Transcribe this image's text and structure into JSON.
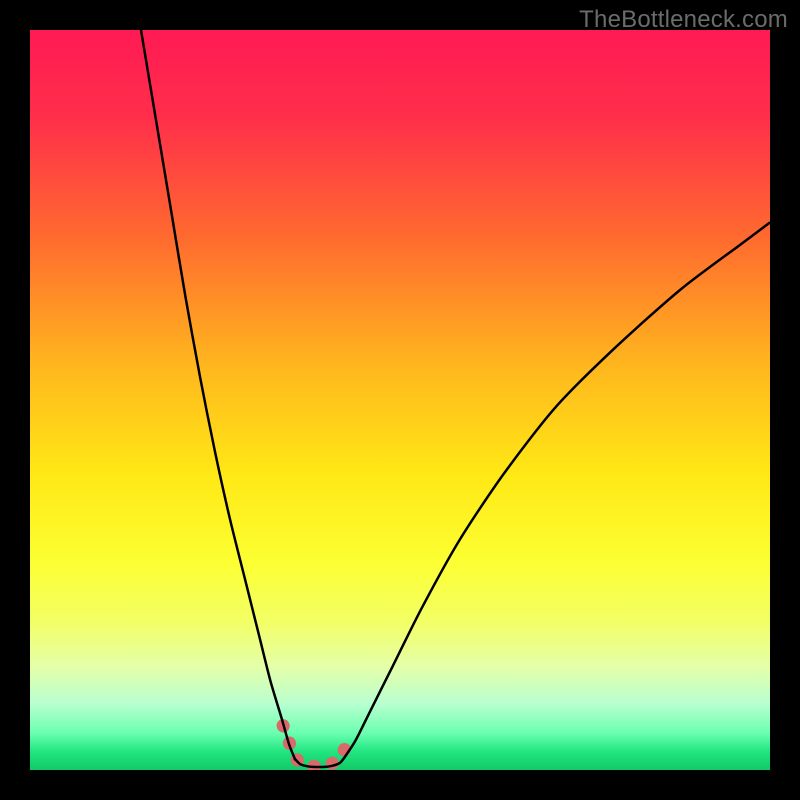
{
  "watermark": {
    "text": "TheBottleneck.com"
  },
  "chart_data": {
    "type": "line",
    "title": "",
    "xlabel": "",
    "ylabel": "",
    "xlim": [
      0,
      100
    ],
    "ylim": [
      0,
      100
    ],
    "grid": false,
    "legend": false,
    "gradient_stops": [
      {
        "offset": 0.0,
        "color": "#ff1a54"
      },
      {
        "offset": 0.12,
        "color": "#ff2f4a"
      },
      {
        "offset": 0.28,
        "color": "#ff6a2f"
      },
      {
        "offset": 0.45,
        "color": "#ffb51e"
      },
      {
        "offset": 0.6,
        "color": "#ffe815"
      },
      {
        "offset": 0.72,
        "color": "#fcff33"
      },
      {
        "offset": 0.8,
        "color": "#f3ff66"
      },
      {
        "offset": 0.86,
        "color": "#e4ffa8"
      },
      {
        "offset": 0.91,
        "color": "#b9ffcf"
      },
      {
        "offset": 0.95,
        "color": "#6bffb0"
      },
      {
        "offset": 0.975,
        "color": "#21e680"
      },
      {
        "offset": 1.0,
        "color": "#12c966"
      }
    ],
    "series": [
      {
        "name": "left-branch",
        "x": [
          15,
          17,
          19,
          21,
          23,
          25,
          27,
          29,
          31,
          32.5,
          34,
          35,
          35.8
        ],
        "y": [
          100,
          88,
          76,
          64,
          53,
          43,
          34,
          26,
          18,
          12,
          7,
          3.5,
          1.5
        ]
      },
      {
        "name": "valley-floor",
        "x": [
          35.8,
          36.5,
          37.5,
          39,
          40.5,
          41.8,
          42.5
        ],
        "y": [
          1.5,
          0.8,
          0.5,
          0.4,
          0.5,
          0.9,
          1.7
        ]
      },
      {
        "name": "right-branch",
        "x": [
          42.5,
          44,
          46,
          49,
          53,
          58,
          64,
          71,
          79,
          88,
          96,
          100
        ],
        "y": [
          1.7,
          4,
          8,
          14,
          22,
          31,
          40,
          49,
          57,
          65,
          71,
          74
        ]
      }
    ],
    "highlight": {
      "name": "valley-highlight",
      "x": [
        34.2,
        34.8,
        35.3,
        35.8,
        36.4,
        37.2,
        38.2,
        39.3,
        40.3,
        41.2,
        41.9,
        42.5,
        43.0
      ],
      "y": [
        6.0,
        4.3,
        3.0,
        1.8,
        1.1,
        0.7,
        0.5,
        0.5,
        0.7,
        1.1,
        1.8,
        2.8,
        3.8
      ]
    },
    "curve_style": {
      "stroke": "#000000",
      "stroke_width": 2.5
    },
    "highlight_style": {
      "stroke": "#d86a6a",
      "stroke_width": 13,
      "linecap": "round",
      "dasharray": "0.5 18"
    }
  }
}
